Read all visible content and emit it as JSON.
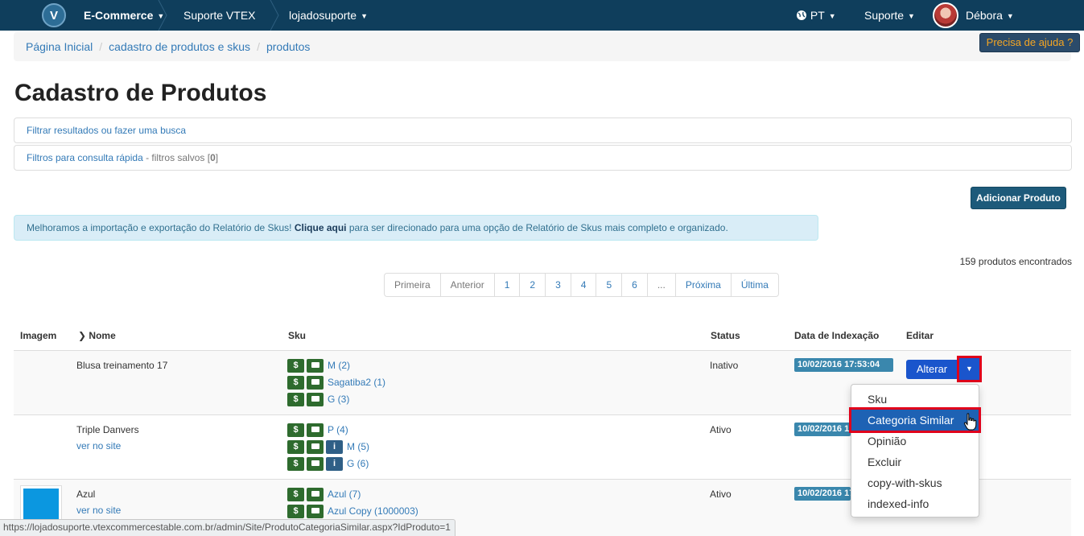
{
  "nav": {
    "logo": "V",
    "app": "E-Commerce",
    "section": "Suporte VTEX",
    "store": "lojadosuporte",
    "language": "PT",
    "support": "Suporte",
    "user": "Débora"
  },
  "breadcrumb": {
    "items": [
      "Página Inicial",
      "cadastro de produtos e skus",
      "produtos"
    ]
  },
  "help_button": "Precisa de ajuda ?",
  "page_title": "Cadastro de Produtos",
  "filters": {
    "search_label": "Filtrar resultados ou fazer uma busca",
    "quick_label": "Filtros para consulta rápida",
    "saved_prefix": " - filtros salvos [",
    "saved_count": "0",
    "saved_suffix": "]"
  },
  "add_product_button": "Adicionar Produto",
  "alert": {
    "before": "Melhoramos a importação e exportação do Relatório de Skus! ",
    "link": "Clique aqui",
    "after": " para ser direcionado para uma opção de Relatório de Skus mais completo e organizado."
  },
  "results_count": "159 produtos encontrados",
  "pagination": [
    "Primeira",
    "Anterior",
    "1",
    "2",
    "3",
    "4",
    "5",
    "6",
    "...",
    "Próxima",
    "Última"
  ],
  "table": {
    "headers": {
      "image": "Imagem",
      "name": "Nome",
      "sku": "Sku",
      "status": "Status",
      "index_date": "Data de Indexação",
      "edit": "Editar"
    },
    "rows": [
      {
        "name": "Blusa treinamento 17",
        "site_link": "",
        "skus": [
          "M (2)",
          "Sagatiba2 (1)",
          "G (3)"
        ],
        "status": "Inativo",
        "date": "10/02/2016 17:53:04"
      },
      {
        "name": "Triple Danvers",
        "site_link": "ver no site",
        "skus": [
          "P (4)",
          "M (5)",
          "G (6)"
        ],
        "status": "Ativo",
        "date": "10/02/2016 17:53:04"
      },
      {
        "name": "Azul",
        "site_link": "ver no site",
        "skus": [
          "Azul (7)",
          "Azul Copy (1000003)"
        ],
        "status": "Ativo",
        "date": "10/02/2016 17:53:04"
      }
    ],
    "sku_dollar_glyph": "$",
    "info_glyph": "i"
  },
  "edit": {
    "alter_button": "Alterar",
    "caret": "▼",
    "dropdown": [
      "Sku",
      "Categoria Similar",
      "Opinião",
      "Excluir",
      "copy-with-skus",
      "indexed-info"
    ],
    "active_item": "Categoria Similar"
  },
  "status_url": "https://lojadosuporte.vtexcommercestable.com.br/admin/Site/ProdutoCategoriaSimilar.aspx?IdProduto=1",
  "colors": {
    "topbar": "#0f3e5c",
    "link": "#337ab7",
    "sku_icon": "#2e6b2e",
    "date_label": "#3a87ad",
    "highlight_border": "#e0001b",
    "primary_button": "#1a55cc"
  }
}
